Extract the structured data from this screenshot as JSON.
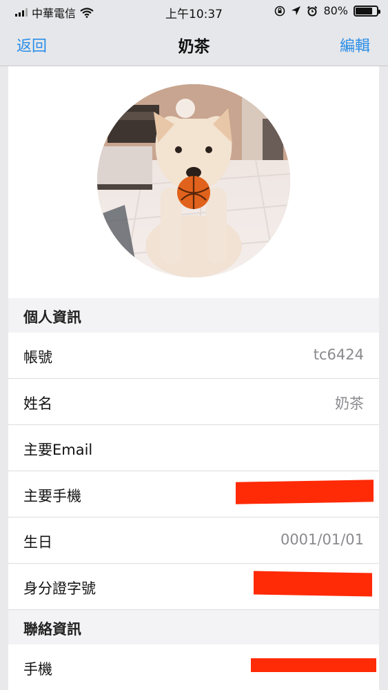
{
  "status_bar": {
    "carrier": "中華電信",
    "time": "上午10:37",
    "battery_percent": "80%",
    "battery_level": 0.8
  },
  "nav": {
    "back_label": "返回",
    "title": "奶茶",
    "edit_label": "編輯"
  },
  "profile": {
    "avatar_description_icon": "dog-avatar"
  },
  "personal_section": {
    "title": "個人資訊",
    "rows": [
      {
        "label": "帳號",
        "value": "tc6424"
      },
      {
        "label": "姓名",
        "value": "奶茶"
      },
      {
        "label": "主要Email",
        "value": ""
      },
      {
        "label": "主要手機",
        "value": ""
      },
      {
        "label": "生日",
        "value": "0001/01/01"
      },
      {
        "label": "身分證字號",
        "value": ""
      }
    ]
  },
  "contact_section": {
    "title": "聯絡資訊",
    "rows": [
      {
        "label": "手機",
        "value": ""
      }
    ]
  },
  "colors": {
    "accent": "#2a8ee8",
    "redaction": "#ff2a06",
    "nav_background": "#e6e7ea",
    "section_background": "#f3f3f5"
  }
}
